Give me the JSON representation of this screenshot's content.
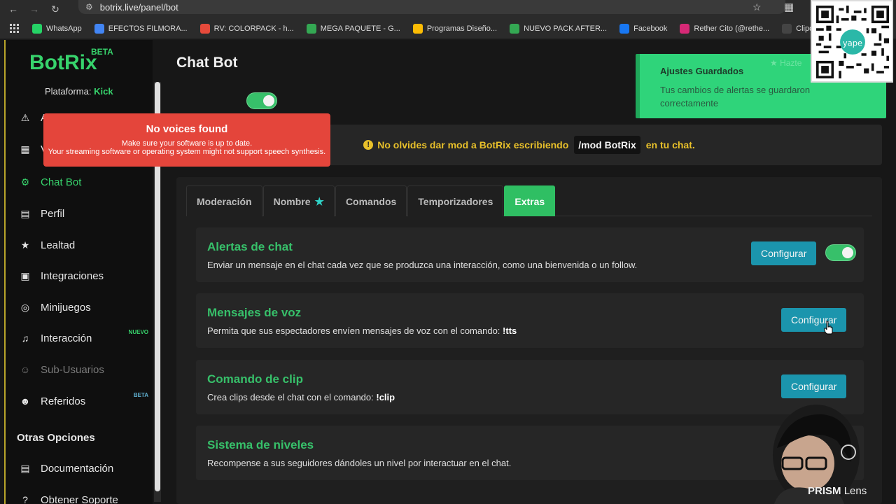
{
  "browser": {
    "url": "botrix.live/panel/bot",
    "bookmarks": [
      {
        "label": "WhatsApp",
        "color": "#25d366"
      },
      {
        "label": "EFECTOS FILMORA...",
        "color": "#4285f4"
      },
      {
        "label": "RV: COLORPACK - h...",
        "color": "#e64a3b"
      },
      {
        "label": "MEGA PAQUETE - G...",
        "color": "#34a853"
      },
      {
        "label": "Programas Diseño...",
        "color": "#fbbc04"
      },
      {
        "label": "NUEVO PACK AFTER...",
        "color": "#34a853"
      },
      {
        "label": "Facebook",
        "color": "#1877f2"
      },
      {
        "label": "Rether Cito (@rethe...",
        "color": "#d62976"
      },
      {
        "label": "Clipdrop - Image up",
        "color": "#444444"
      }
    ]
  },
  "brand": {
    "name": "BotRix",
    "tag": "BETA"
  },
  "platform": {
    "label": "Plataforma:",
    "value": "Kick"
  },
  "sidebar": {
    "items": [
      {
        "label": "A",
        "icon": "warning-icon"
      },
      {
        "label": "V",
        "icon": "windows-icon"
      },
      {
        "label": "Chat Bot",
        "icon": "robot-icon"
      },
      {
        "label": "Perfil",
        "icon": "id-card-icon"
      },
      {
        "label": "Lealtad",
        "icon": "trophy-icon"
      },
      {
        "label": "Integraciones",
        "icon": "plug-icon"
      },
      {
        "label": "Minijuegos",
        "icon": "gamepad-icon"
      },
      {
        "label": "Interacción",
        "icon": "music-icon",
        "badge": "NUEVO"
      },
      {
        "label": "Sub-Usuarios",
        "icon": "users-icon"
      },
      {
        "label": "Referidos",
        "icon": "user-group-icon",
        "badge": "BETA"
      }
    ],
    "section_title": "Otras Opciones",
    "extra": [
      {
        "label": "Documentación",
        "icon": "document-icon"
      },
      {
        "label": "Obtener Soporte",
        "icon": "question-icon"
      }
    ]
  },
  "main": {
    "title": "Chat Bot",
    "banner": {
      "pre": "No olvides dar mod a BotRix escribiendo",
      "code": "/mod BotRix",
      "post": "en tu chat."
    },
    "tabs": [
      "Moderación",
      "Nombre",
      "Comandos",
      "Temporizadores",
      "Extras"
    ],
    "rows": [
      {
        "title": "Alertas de chat",
        "desc": "Enviar un mensaje en el chat cada vez que se produzca una interacción, como una bienvenida o un follow.",
        "button": "Configurar"
      },
      {
        "title": "Mensajes de voz",
        "desc": "Permita que sus espectadores envíen mensajes de voz con el comando:",
        "cmd": "!tts",
        "button": "Configurar"
      },
      {
        "title": "Comando de clip",
        "desc": "Crea clips desde el chat con el comando:",
        "cmd": "!clip",
        "button": "Configurar"
      },
      {
        "title": "Sistema de niveles",
        "desc": "Recompense a sus seguidores dándoles un nivel por interactuar en el chat."
      }
    ]
  },
  "toast_error": {
    "title": "No voices found",
    "line1": "Make sure your software is up to date.",
    "line2": "Your streaming software or operating system might not support speech synthesis."
  },
  "toast_success": {
    "title": "Ajustes Guardados",
    "message": "Tus cambios de alertas se guardaron correctamente",
    "behind": "Hazte"
  },
  "qr_label": "yape",
  "watermark": {
    "bold": "PRISM",
    "light": "Lens"
  },
  "colors": {
    "accent": "#37c06a",
    "button": "#1b95ad",
    "error": "#e4453b",
    "success": "#2fd47a",
    "warning": "#e8c02a"
  }
}
